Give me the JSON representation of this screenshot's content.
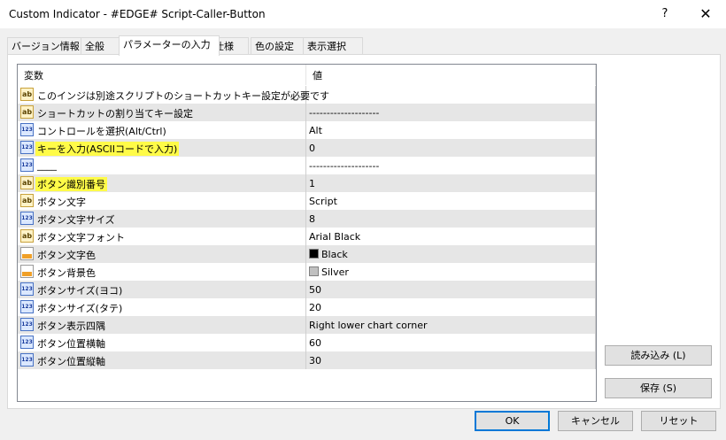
{
  "window": {
    "title": "Custom Indicator - #EDGE# Script-Caller-Button",
    "help_label": "?",
    "close_label": "✕"
  },
  "tabs": [
    {
      "label": "バージョン情報"
    },
    {
      "label": "全般"
    },
    {
      "label": "パラメーターの入力",
      "active": true
    },
    {
      "label": "仕様"
    },
    {
      "label": "色の設定"
    },
    {
      "label": "表示選択"
    }
  ],
  "grid": {
    "headers": {
      "variable": "変数",
      "value": "値"
    },
    "rows": [
      {
        "name": "このインジは別途スクリプトのショートカットキー設定が必要です",
        "value": "",
        "icon": "string-icon",
        "highlight": false
      },
      {
        "name": "ショートカットの割り当てキー設定",
        "value": "--------------------",
        "icon": "string-icon",
        "highlight": false
      },
      {
        "name": "コントロールを選択(Alt/Ctrl)",
        "value": "Alt",
        "icon": "number-icon",
        "highlight": false
      },
      {
        "name": "キーを入力(ASCIIコードで入力)",
        "value": "0",
        "icon": "number-icon",
        "highlight": true
      },
      {
        "name": "____",
        "value": "--------------------",
        "icon": "number-icon",
        "highlight": false
      },
      {
        "name": "ボタン識別番号",
        "value": "1",
        "icon": "string-icon",
        "highlight": true
      },
      {
        "name": "ボタン文字",
        "value": "Script",
        "icon": "string-icon",
        "highlight": false
      },
      {
        "name": "ボタン文字サイズ",
        "value": "8",
        "icon": "number-icon",
        "highlight": false
      },
      {
        "name": "ボタン文字フォント",
        "value": "Arial Black",
        "icon": "string-icon",
        "highlight": false
      },
      {
        "name": "ボタン文字色",
        "value": "Black",
        "icon": "color-icon",
        "highlight": false,
        "swatch": "#000000"
      },
      {
        "name": "ボタン背景色",
        "value": "Silver",
        "icon": "color-icon",
        "highlight": false,
        "swatch": "#c0c0c0"
      },
      {
        "name": "ボタンサイズ(ヨコ)",
        "value": "50",
        "icon": "number-icon",
        "highlight": false
      },
      {
        "name": "ボタンサイズ(タテ)",
        "value": "20",
        "icon": "number-icon",
        "highlight": false
      },
      {
        "name": "ボタン表示四隅",
        "value": "Right lower chart corner",
        "icon": "number-icon",
        "highlight": false
      },
      {
        "name": "ボタン位置横軸",
        "value": "60",
        "icon": "number-icon",
        "highlight": false
      },
      {
        "name": "ボタン位置縦軸",
        "value": "30",
        "icon": "number-icon",
        "highlight": false
      }
    ]
  },
  "side_buttons": {
    "load": "読み込み (L)",
    "save": "保存 (S)"
  },
  "footer_buttons": {
    "ok": "OK",
    "cancel": "キャンセル",
    "reset": "リセット"
  },
  "colors": {
    "highlight": "#fffb48",
    "accent": "#0078d7"
  }
}
